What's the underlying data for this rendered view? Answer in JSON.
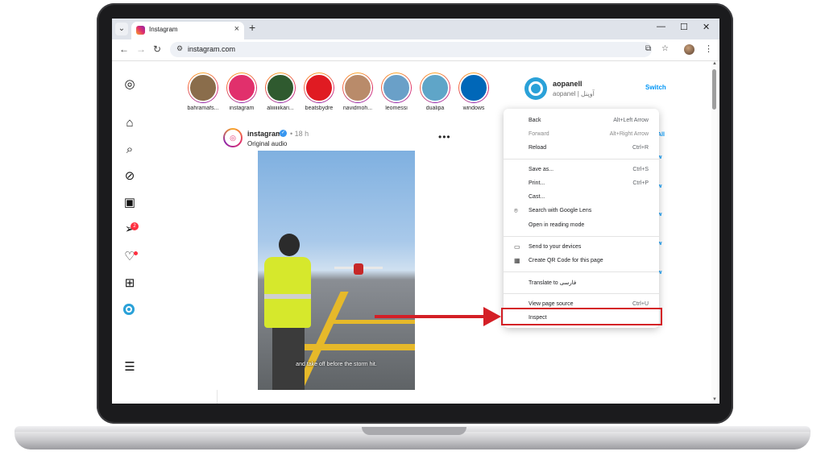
{
  "browser": {
    "tab_title": "Instagram",
    "tab_close": "×",
    "new_tab": "+",
    "tab_menu": "⌄",
    "url": "instagram.com",
    "window_controls": {
      "minimize": "—",
      "maximize": "☐",
      "close": "✕"
    }
  },
  "stories": [
    {
      "name": "bahramafs...",
      "color": "#8a6d4b"
    },
    {
      "name": "instagram",
      "color": "#e1306c"
    },
    {
      "name": "aliiiiiiikari...",
      "color": "#2f5a2f"
    },
    {
      "name": "beatsbydre",
      "color": "#e01b22"
    },
    {
      "name": "navidmoh...",
      "color": "#b98b6a"
    },
    {
      "name": "leomessi",
      "color": "#6aa0c8"
    },
    {
      "name": "dualipa",
      "color": "#5fa5c8"
    },
    {
      "name": "windows",
      "color": "#0067b8"
    }
  ],
  "post": {
    "username": "instagram",
    "verified_mark": "✓",
    "time": "• 18 h",
    "audio": "Original audio",
    "more": "•••",
    "caption": "and take off before the storm hit."
  },
  "account": {
    "username": "aopanell",
    "display_name": "aopanel | آوپنل",
    "switch_label": "Switch"
  },
  "peek_links": [
    "All",
    "w",
    "w",
    "w",
    "w",
    "w"
  ],
  "context_menu": {
    "items": [
      {
        "label": "Back",
        "shortcut": "Alt+Left Arrow",
        "enabled": true,
        "icon": ""
      },
      {
        "label": "Forward",
        "shortcut": "Alt+Right Arrow",
        "enabled": false,
        "icon": ""
      },
      {
        "label": "Reload",
        "shortcut": "Ctrl+R",
        "enabled": true,
        "icon": ""
      },
      {
        "label": "Save as...",
        "shortcut": "Ctrl+S",
        "enabled": true,
        "icon": ""
      },
      {
        "label": "Print...",
        "shortcut": "Ctrl+P",
        "enabled": true,
        "icon": ""
      },
      {
        "label": "Cast...",
        "shortcut": "",
        "enabled": true,
        "icon": ""
      },
      {
        "label": "Search with Google Lens",
        "shortcut": "",
        "enabled": true,
        "icon": "lens-icon"
      },
      {
        "label": "Open in reading mode",
        "shortcut": "",
        "enabled": true,
        "icon": ""
      },
      {
        "label": "Send to your devices",
        "shortcut": "",
        "enabled": true,
        "icon": "devices-icon"
      },
      {
        "label": "Create QR Code for this page",
        "shortcut": "",
        "enabled": true,
        "icon": "qr-icon"
      },
      {
        "label": "Translate to فارسی",
        "shortcut": "",
        "enabled": true,
        "icon": ""
      },
      {
        "label": "View page source",
        "shortcut": "Ctrl+U",
        "enabled": true,
        "icon": ""
      },
      {
        "label": "Inspect",
        "shortcut": "",
        "enabled": true,
        "icon": ""
      }
    ]
  },
  "notifications": {
    "messages_badge": "2"
  },
  "colors": {
    "accent": "#0095f6",
    "annotation": "#d41f26",
    "badge": "#ff3040"
  }
}
